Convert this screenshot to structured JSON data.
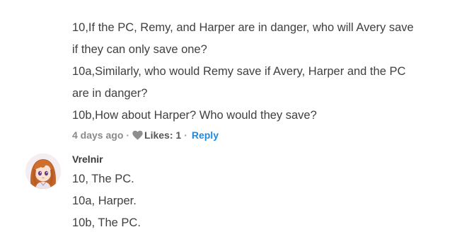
{
  "comment1": {
    "lines": [
      "10,If the PC, Remy, and Harper are in danger, who will Avery save",
      "if they can only save one?",
      "10a,Similarly, who would Remy save if Avery, Harper and the PC",
      "are in danger?",
      "10b,How about Harper? Who would they save?"
    ],
    "meta": {
      "time": "4 days ago",
      "separator": "·",
      "likes": "Likes: 1",
      "separator2": "·",
      "reply": "Reply"
    }
  },
  "comment2": {
    "username": "Vrelnir",
    "lines": [
      "10, The PC.",
      "10a, Harper.",
      "10b, The PC."
    ]
  },
  "colors": {
    "link": "#1c8be0",
    "text": "#404040",
    "meta": "#8a8a8a"
  },
  "icons": {
    "likes": "heart-icon",
    "avatar": "user-avatar-image"
  }
}
